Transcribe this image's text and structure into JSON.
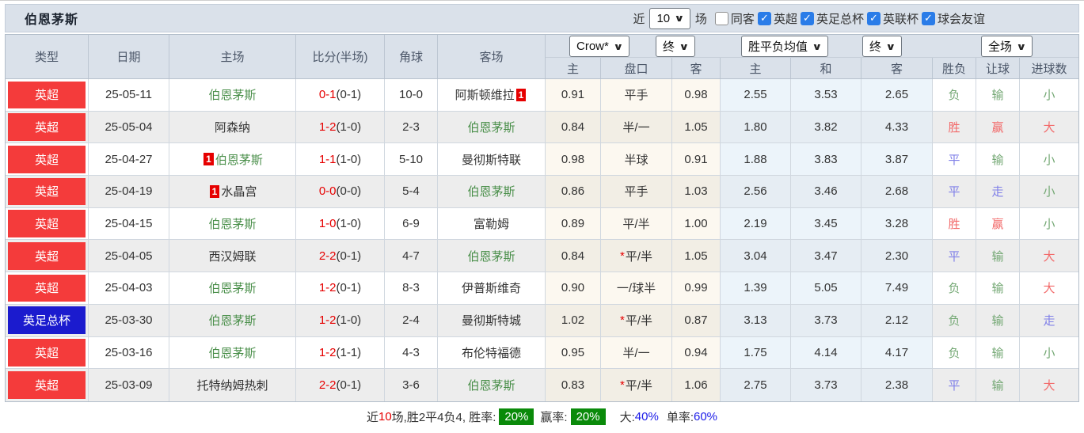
{
  "title": "伯恩茅斯",
  "topbar": {
    "near_label": "近",
    "count": "10",
    "unit_label": "场",
    "checkboxes": [
      {
        "name": "same-venue",
        "label": "同客",
        "checked": false
      },
      {
        "name": "epl",
        "label": "英超",
        "checked": true
      },
      {
        "name": "fa-cup",
        "label": "英足总杯",
        "checked": true
      },
      {
        "name": "league-cup",
        "label": "英联杯",
        "checked": true
      },
      {
        "name": "club-friendly",
        "label": "球会友谊",
        "checked": true
      }
    ]
  },
  "table": {
    "left_headers": [
      "类型",
      "日期",
      "主场",
      "比分(半场)",
      "角球",
      "客场"
    ],
    "sub_headers": [
      "主",
      "盘口",
      "客",
      "主",
      "和",
      "客",
      "胜负",
      "让球",
      "进球数"
    ],
    "filters": {
      "company": "Crow*",
      "company_time": "终",
      "avg": "胜平负均值",
      "avg_time": "终",
      "scope": "全场"
    },
    "card_text": "1",
    "star_text": "*",
    "rows": [
      {
        "league": "英超",
        "league_color": "red",
        "date": "25-05-11",
        "home": {
          "name": "伯恩茅斯",
          "self": true,
          "card": null
        },
        "score": {
          "ft": "0-1",
          "ht": "(0-1)"
        },
        "corners": "10-0",
        "away": {
          "name": "阿斯顿维拉",
          "self": false,
          "card": "after"
        },
        "ah": {
          "home": "0.91",
          "line": "平手",
          "star": false,
          "away": "0.98"
        },
        "eu": {
          "home": "2.55",
          "draw": "3.53",
          "away": "2.65"
        },
        "res": [
          {
            "t": "负",
            "c": "t-green"
          },
          {
            "t": "输",
            "c": "t-green"
          },
          {
            "t": "小",
            "c": "t-green"
          }
        ]
      },
      {
        "league": "英超",
        "league_color": "red",
        "date": "25-05-04",
        "home": {
          "name": "阿森纳",
          "self": false,
          "card": null
        },
        "score": {
          "ft": "1-2",
          "ht": "(1-0)"
        },
        "corners": "2-3",
        "away": {
          "name": "伯恩茅斯",
          "self": true,
          "card": null
        },
        "ah": {
          "home": "0.84",
          "line": "半/一",
          "star": false,
          "away": "1.05"
        },
        "eu": {
          "home": "1.80",
          "draw": "3.82",
          "away": "4.33"
        },
        "res": [
          {
            "t": "胜",
            "c": "t-red"
          },
          {
            "t": "赢",
            "c": "t-red"
          },
          {
            "t": "大",
            "c": "t-red"
          }
        ]
      },
      {
        "league": "英超",
        "league_color": "red",
        "date": "25-04-27",
        "home": {
          "name": "伯恩茅斯",
          "self": true,
          "card": "before"
        },
        "score": {
          "ft": "1-1",
          "ht": "(1-0)"
        },
        "corners": "5-10",
        "away": {
          "name": "曼彻斯特联",
          "self": false,
          "card": null
        },
        "ah": {
          "home": "0.98",
          "line": "半球",
          "star": false,
          "away": "0.91"
        },
        "eu": {
          "home": "1.88",
          "draw": "3.83",
          "away": "3.87"
        },
        "res": [
          {
            "t": "平",
            "c": "t-blue"
          },
          {
            "t": "输",
            "c": "t-green"
          },
          {
            "t": "小",
            "c": "t-green"
          }
        ]
      },
      {
        "league": "英超",
        "league_color": "red",
        "date": "25-04-19",
        "home": {
          "name": "水晶宫",
          "self": false,
          "card": "before"
        },
        "score": {
          "ft": "0-0",
          "ht": "(0-0)"
        },
        "corners": "5-4",
        "away": {
          "name": "伯恩茅斯",
          "self": true,
          "card": null
        },
        "ah": {
          "home": "0.86",
          "line": "平手",
          "star": false,
          "away": "1.03"
        },
        "eu": {
          "home": "2.56",
          "draw": "3.46",
          "away": "2.68"
        },
        "res": [
          {
            "t": "平",
            "c": "t-blue"
          },
          {
            "t": "走",
            "c": "t-blue"
          },
          {
            "t": "小",
            "c": "t-green"
          }
        ]
      },
      {
        "league": "英超",
        "league_color": "red",
        "date": "25-04-15",
        "home": {
          "name": "伯恩茅斯",
          "self": true,
          "card": null
        },
        "score": {
          "ft": "1-0",
          "ht": "(1-0)"
        },
        "corners": "6-9",
        "away": {
          "name": "富勒姆",
          "self": false,
          "card": null
        },
        "ah": {
          "home": "0.89",
          "line": "平/半",
          "star": false,
          "away": "1.00"
        },
        "eu": {
          "home": "2.19",
          "draw": "3.45",
          "away": "3.28"
        },
        "res": [
          {
            "t": "胜",
            "c": "t-red"
          },
          {
            "t": "赢",
            "c": "t-red"
          },
          {
            "t": "小",
            "c": "t-green"
          }
        ]
      },
      {
        "league": "英超",
        "league_color": "red",
        "date": "25-04-05",
        "home": {
          "name": "西汉姆联",
          "self": false,
          "card": null
        },
        "score": {
          "ft": "2-2",
          "ht": "(0-1)"
        },
        "corners": "4-7",
        "away": {
          "name": "伯恩茅斯",
          "self": true,
          "card": null
        },
        "ah": {
          "home": "0.84",
          "line": "平/半",
          "star": true,
          "away": "1.05"
        },
        "eu": {
          "home": "3.04",
          "draw": "3.47",
          "away": "2.30"
        },
        "res": [
          {
            "t": "平",
            "c": "t-blue"
          },
          {
            "t": "输",
            "c": "t-green"
          },
          {
            "t": "大",
            "c": "t-red"
          }
        ]
      },
      {
        "league": "英超",
        "league_color": "red",
        "date": "25-04-03",
        "home": {
          "name": "伯恩茅斯",
          "self": true,
          "card": null
        },
        "score": {
          "ft": "1-2",
          "ht": "(0-1)"
        },
        "corners": "8-3",
        "away": {
          "name": "伊普斯维奇",
          "self": false,
          "card": null
        },
        "ah": {
          "home": "0.90",
          "line": "一/球半",
          "star": false,
          "away": "0.99"
        },
        "eu": {
          "home": "1.39",
          "draw": "5.05",
          "away": "7.49"
        },
        "res": [
          {
            "t": "负",
            "c": "t-green"
          },
          {
            "t": "输",
            "c": "t-green"
          },
          {
            "t": "大",
            "c": "t-red"
          }
        ]
      },
      {
        "league": "英足总杯",
        "league_color": "blue",
        "date": "25-03-30",
        "home": {
          "name": "伯恩茅斯",
          "self": true,
          "card": null
        },
        "score": {
          "ft": "1-2",
          "ht": "(1-0)"
        },
        "corners": "2-4",
        "away": {
          "name": "曼彻斯特城",
          "self": false,
          "card": null
        },
        "ah": {
          "home": "1.02",
          "line": "平/半",
          "star": true,
          "away": "0.87"
        },
        "eu": {
          "home": "3.13",
          "draw": "3.73",
          "away": "2.12"
        },
        "res": [
          {
            "t": "负",
            "c": "t-green"
          },
          {
            "t": "输",
            "c": "t-green"
          },
          {
            "t": "走",
            "c": "t-blue"
          }
        ]
      },
      {
        "league": "英超",
        "league_color": "red",
        "date": "25-03-16",
        "home": {
          "name": "伯恩茅斯",
          "self": true,
          "card": null
        },
        "score": {
          "ft": "1-2",
          "ht": "(1-1)"
        },
        "corners": "4-3",
        "away": {
          "name": "布伦特福德",
          "self": false,
          "card": null
        },
        "ah": {
          "home": "0.95",
          "line": "半/一",
          "star": false,
          "away": "0.94"
        },
        "eu": {
          "home": "1.75",
          "draw": "4.14",
          "away": "4.17"
        },
        "res": [
          {
            "t": "负",
            "c": "t-green"
          },
          {
            "t": "输",
            "c": "t-green"
          },
          {
            "t": "小",
            "c": "t-green"
          }
        ]
      },
      {
        "league": "英超",
        "league_color": "red",
        "date": "25-03-09",
        "home": {
          "name": "托特纳姆热刺",
          "self": false,
          "card": null
        },
        "score": {
          "ft": "2-2",
          "ht": "(0-1)"
        },
        "corners": "3-6",
        "away": {
          "name": "伯恩茅斯",
          "self": true,
          "card": null
        },
        "ah": {
          "home": "0.83",
          "line": "平/半",
          "star": true,
          "away": "1.06"
        },
        "eu": {
          "home": "2.75",
          "draw": "3.73",
          "away": "2.38"
        },
        "res": [
          {
            "t": "平",
            "c": "t-blue"
          },
          {
            "t": "输",
            "c": "t-green"
          },
          {
            "t": "大",
            "c": "t-red"
          }
        ]
      }
    ]
  },
  "summary": {
    "prefix": "近",
    "count": "10",
    "middle": "场,胜2平4负4, 胜率:",
    "win_rate": "20%",
    "win_odds_label": "赢率:",
    "win_odds_rate": "20%",
    "big_label": "大:",
    "big_value": "40%",
    "single_label": "单率:",
    "single_value": "60%"
  },
  "colors": {
    "league_red": "#f43b3b",
    "league_blue": "#1b1bce",
    "self_team_green": "#4a8f4a",
    "score_red": "#e60000",
    "result_red": "#f26a6a",
    "result_green": "#74a874",
    "result_blue": "#8080e8",
    "rate_badge_green": "#0a8a0a",
    "percent_blue": "#1a1ae8",
    "checkbox_blue": "#2a7ce8",
    "header_bg": "#dae1ea"
  }
}
